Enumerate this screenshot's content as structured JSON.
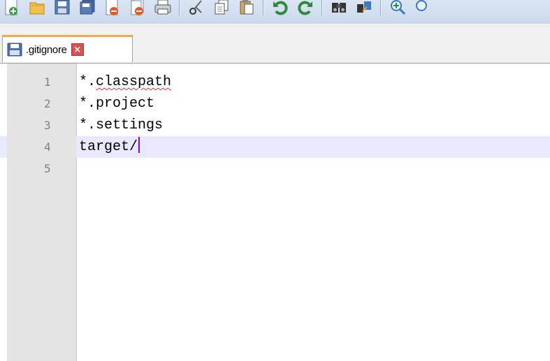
{
  "toolbar": {
    "buttons": [
      {
        "name": "new-file-icon"
      },
      {
        "name": "open-file-icon"
      },
      {
        "name": "save-icon"
      },
      {
        "name": "save-all-icon"
      },
      {
        "name": "close-icon"
      },
      {
        "name": "close-all-icon"
      },
      {
        "name": "print-icon"
      },
      {
        "name": "cut-icon"
      },
      {
        "name": "copy-icon"
      },
      {
        "name": "paste-icon"
      },
      {
        "name": "undo-icon"
      },
      {
        "name": "redo-icon"
      },
      {
        "name": "find-icon"
      },
      {
        "name": "replace-icon"
      },
      {
        "name": "zoom-in-icon"
      }
    ]
  },
  "tab": {
    "label": ".gitignore",
    "icon": "saved-file-icon",
    "close": "×",
    "accent": "#f9a64b"
  },
  "editor": {
    "lines": [
      {
        "num": "1",
        "text": "*.classpath"
      },
      {
        "num": "2",
        "text": "*.project"
      },
      {
        "num": "3",
        "text": "*.settings"
      },
      {
        "num": "4",
        "text": "target/"
      },
      {
        "num": "5",
        "text": ""
      }
    ],
    "current_line": 4,
    "current_line_color": "#e8e8ff",
    "caret_color": "#8000ff",
    "spellcheck_color": "#e03030"
  }
}
